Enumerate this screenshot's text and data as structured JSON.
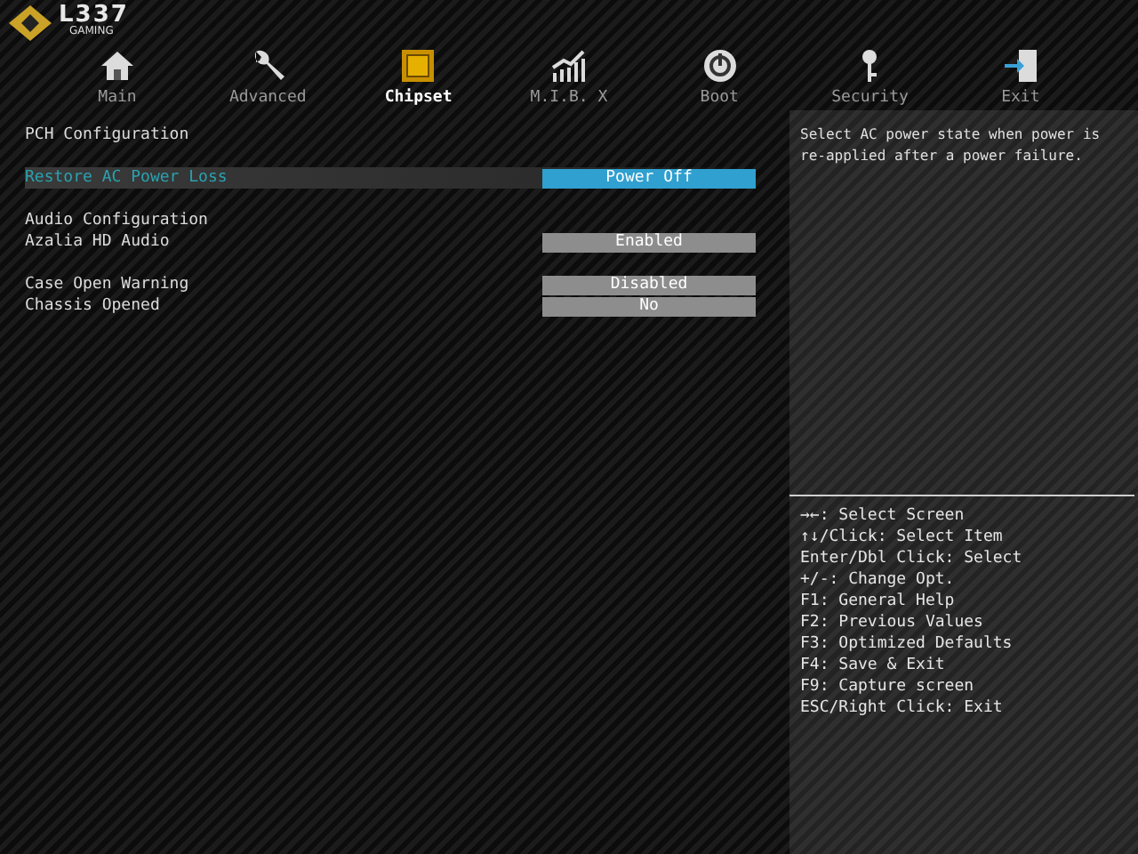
{
  "logo": {
    "mark": "L337",
    "sub": "GAMING"
  },
  "tabs": [
    {
      "label": "Main",
      "kind": "home",
      "selected": false
    },
    {
      "label": "Advanced",
      "kind": "wrench",
      "selected": false
    },
    {
      "label": "Chipset",
      "kind": "chip",
      "selected": true
    },
    {
      "label": "M.I.B. X",
      "kind": "chart",
      "selected": false
    },
    {
      "label": "Boot",
      "kind": "power",
      "selected": false
    },
    {
      "label": "Security",
      "kind": "key",
      "selected": false
    },
    {
      "label": "Exit",
      "kind": "exit",
      "selected": false
    }
  ],
  "setting_groups": [
    {
      "items": [
        {
          "kind": "heading",
          "label": "PCH Configuration"
        }
      ]
    },
    {
      "items": [
        {
          "kind": "option",
          "label": "Restore AC Power Loss",
          "value": "Power Off",
          "selected": true
        }
      ]
    },
    {
      "items": [
        {
          "kind": "heading",
          "label": "Audio Configuration"
        },
        {
          "kind": "option",
          "label": "Azalia HD Audio",
          "value": "Enabled",
          "selected": false
        }
      ]
    },
    {
      "items": [
        {
          "kind": "option",
          "label": "Case Open Warning",
          "value": "Disabled",
          "selected": false
        },
        {
          "kind": "option",
          "label": "Chassis Opened",
          "value": "No",
          "selected": false
        }
      ]
    }
  ],
  "help_text": "Select AC power state when power is re-applied after a power failure.",
  "key_help": [
    "→←: Select Screen",
    "↑↓/Click: Select Item",
    "Enter/Dbl Click: Select",
    "+/-: Change Opt.",
    "F1: General Help",
    "F2: Previous Values",
    "F3: Optimized Defaults",
    "F4: Save & Exit",
    "F9: Capture screen",
    "ESC/Right Click: Exit"
  ]
}
